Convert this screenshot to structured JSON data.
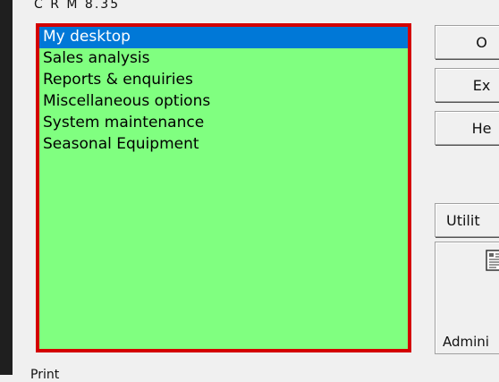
{
  "app": {
    "title": "C R M  8.35"
  },
  "menu": {
    "items": [
      {
        "label": "My desktop",
        "selected": true
      },
      {
        "label": "Sales analysis"
      },
      {
        "label": "Reports & enquiries"
      },
      {
        "label": "Miscellaneous options"
      },
      {
        "label": "System maintenance"
      },
      {
        "label": "Seasonal Equipment"
      }
    ]
  },
  "buttons": {
    "b1": "O",
    "b2": "Ex",
    "b3": "He",
    "utilities": "Utilit",
    "admin": "Admini"
  },
  "footer": {
    "text": "Print"
  },
  "colors": {
    "menu_bg": "#80ff80",
    "selection": "#0078d7",
    "frame": "#d40000"
  }
}
